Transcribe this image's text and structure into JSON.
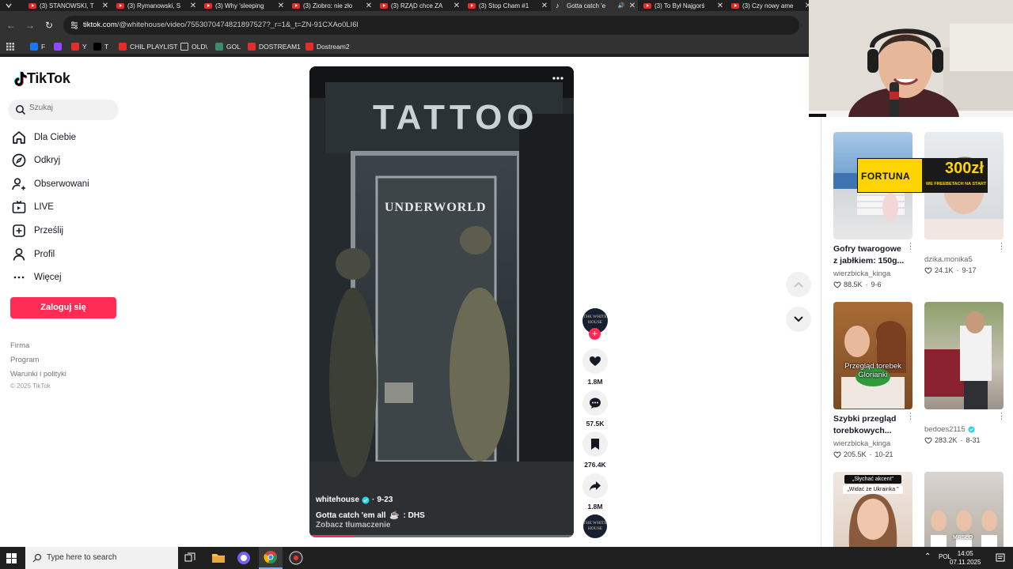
{
  "browser": {
    "tabs": [
      {
        "title": "(3) STANOWSKI, T",
        "type": "youtube"
      },
      {
        "title": "(3) Rymanowski, S",
        "type": "youtube"
      },
      {
        "title": "(3) Why 'sleeping",
        "type": "youtube"
      },
      {
        "title": "(3) Ziobro: nie zło",
        "type": "youtube"
      },
      {
        "title": "(3) RZĄD chce ZA",
        "type": "youtube"
      },
      {
        "title": "(3) Stop Cham #1",
        "type": "youtube"
      },
      {
        "title": "Gotta catch 'e",
        "type": "tiktok",
        "active": true
      },
      {
        "title": "(3) To Był Najgorś",
        "type": "youtube"
      },
      {
        "title": "(3) Czy nowy ame",
        "type": "youtube"
      }
    ],
    "url_host": "tiktok.com",
    "url_path": "/@whitehouse/video/7553070474821897527?_r=1&_t=ZN-91CXAo0LI6l",
    "bookmarks": [
      {
        "label": "F",
        "color": "#1877f2"
      },
      {
        "label": "",
        "color": "#9146ff"
      },
      {
        "label": "Y",
        "color": "#e52d27"
      },
      {
        "label": "T",
        "color": "#000000"
      },
      {
        "label": "CHIL PLAYLIST",
        "color": "#e52d27"
      },
      {
        "label": "OLD\\",
        "color": "folder"
      },
      {
        "label": "GOL",
        "color": "#3a8d6b"
      },
      {
        "label": "DOSTREAM1",
        "color": "#e52d27"
      },
      {
        "label": "Dostream2",
        "color": "#e52d27"
      }
    ]
  },
  "tiktok": {
    "logo": "TikTok",
    "search_placeholder": "Szukaj",
    "nav": [
      {
        "label": "Dla Ciebie",
        "icon": "home-icon"
      },
      {
        "label": "Odkryj",
        "icon": "compass-icon"
      },
      {
        "label": "Obserwowani",
        "icon": "following-icon"
      },
      {
        "label": "LIVE",
        "icon": "live-icon"
      },
      {
        "label": "Prześlij",
        "icon": "upload-icon"
      },
      {
        "label": "Profil",
        "icon": "profile-icon"
      },
      {
        "label": "Więcej",
        "icon": "more-icon"
      }
    ],
    "login_button": "Zaloguj się",
    "footer_links": [
      "Firma",
      "Program",
      "Warunki i polityki"
    ],
    "copyright": "© 2025 TikTok",
    "accent": "#fe2c55"
  },
  "video": {
    "author": "whitehouse",
    "date": "9-23",
    "caption": "Gotta catch 'em all",
    "caption_suffix": ": DHS",
    "translate": "Zobacz tłumaczenie",
    "sign_tattoo": "TATTOO",
    "sign_store": "UNDERWORLD",
    "progress": 0.17,
    "author_avatar_text": "THE WHITE HOUSE",
    "likes": "1.8M",
    "comments": "57.5K",
    "saves": "276.4K",
    "shares": "1.8M"
  },
  "recommended": [
    {
      "title": "Gofry twarogowe z jabłkiem: 150g...",
      "user": "wierzbicka_kinga",
      "likes": "88.5K",
      "date": "9-6",
      "verified": false
    },
    {
      "title": "",
      "user": "dzika.monika5",
      "likes": "24.1K",
      "date": "9-17",
      "verified": false
    },
    {
      "title": "Szybki przegląd torebkowych...",
      "user": "wierzbicka_kinga",
      "likes": "205.5K",
      "date": "10-21",
      "verified": false,
      "overlay": "Przegląd torebek Glorianki"
    },
    {
      "title": "",
      "user": "bedoes2115",
      "likes": "283.2K",
      "date": "8-31",
      "verified": true
    },
    {
      "overlay1": "„Słychać akcent\"",
      "overlay2": "„Widać że Ukrainka \""
    },
    {
      "overlay1": "MASŁO"
    }
  ],
  "ad": {
    "brand": "FORTUNA",
    "amount": "300zł",
    "sub": "WE FREEBETACH NA START"
  },
  "taskbar": {
    "search_placeholder": "Type here to search",
    "lang": "POL",
    "time": "14:05",
    "date": "07.11.2025"
  }
}
